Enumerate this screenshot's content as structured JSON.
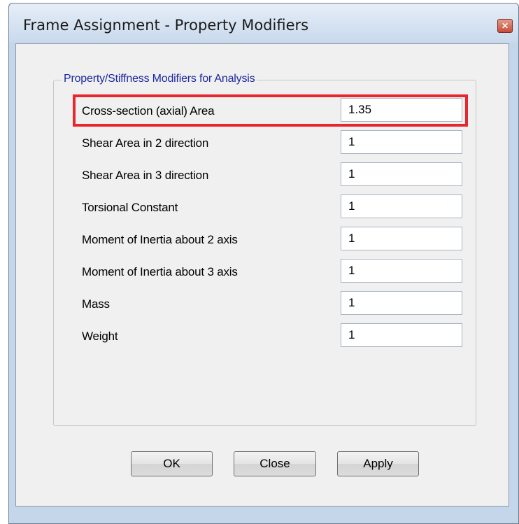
{
  "window": {
    "title": "Frame Assignment - Property Modifiers",
    "close_icon": "close-icon"
  },
  "group": {
    "legend": "Property/Stiffness Modifiers for Analysis"
  },
  "fields": [
    {
      "label": "Cross-section (axial) Area",
      "value": "1.35",
      "highlighted": true
    },
    {
      "label": "Shear Area in 2 direction",
      "value": "1"
    },
    {
      "label": "Shear Area in 3 direction",
      "value": "1"
    },
    {
      "label": "Torsional Constant",
      "value": "1"
    },
    {
      "label": "Moment of Inertia about 2 axis",
      "value": "1"
    },
    {
      "label": "Moment of Inertia about 3 axis",
      "value": "1"
    },
    {
      "label": "Mass",
      "value": "1"
    },
    {
      "label": "Weight",
      "value": "1"
    }
  ],
  "buttons": {
    "ok": "OK",
    "close": "Close",
    "apply": "Apply"
  },
  "colors": {
    "highlight": "#e8262d",
    "legend_text": "#1f2aa0",
    "dialog_background": "#f0f0f0"
  }
}
